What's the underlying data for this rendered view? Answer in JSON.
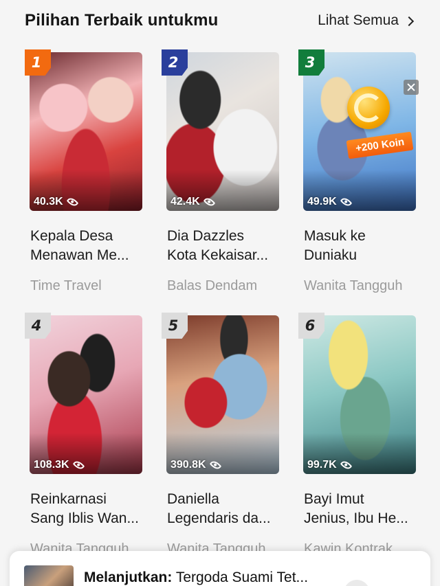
{
  "section": {
    "title": "Pilihan Terbaik untukmu",
    "see_all_label": "Lihat Semua"
  },
  "colors": {
    "rank_1": "#f26a10",
    "rank_2": "#2a3f9c",
    "rank_3": "#127d3c",
    "rank_default": "#dcdcdc",
    "genre_text": "#9b9b9b"
  },
  "items": [
    {
      "rank": "1",
      "views": "40.3K",
      "title_line1": "Kepala Desa",
      "title_line2": "Menawan Me...",
      "genre": "Time Travel"
    },
    {
      "rank": "2",
      "views": "42.4K",
      "title_line1": "Dia Dazzles",
      "title_line2": "Kota Kekaisar...",
      "genre": "Balas Dendam"
    },
    {
      "rank": "3",
      "views": "49.9K",
      "title_line1": "Masuk ke",
      "title_line2": "Duniaku",
      "genre": "Wanita Tangguh"
    },
    {
      "rank": "4",
      "views": "108.3K",
      "title_line1": "Reinkarnasi",
      "title_line2": "Sang Iblis Wan...",
      "genre": "Wanita Tangguh"
    },
    {
      "rank": "5",
      "views": "390.8K",
      "title_line1": "Daniella",
      "title_line2": "Legendaris da...",
      "genre": "Wanita Tangguh"
    },
    {
      "rank": "6",
      "views": "99.7K",
      "title_line1": "Bayi Imut",
      "title_line2": "Jenius, Ibu He...",
      "genre": "Kawin Kontrak"
    }
  ],
  "coin_promo": {
    "label": "+200 Koin",
    "icon": "coin-icon"
  },
  "continue_bar": {
    "prefix": "Melanjutkan:",
    "title": "Tergoda Suami Tet..."
  }
}
